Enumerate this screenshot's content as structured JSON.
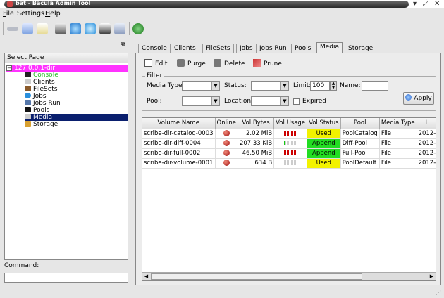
{
  "window": {
    "title": "bat - Bacula Admin Tool",
    "controls": [
      "▾",
      "⤢",
      "✕"
    ]
  },
  "menu": [
    "File",
    "Settings",
    "Help"
  ],
  "left": {
    "select_page_label": "Select Page",
    "root": "127.0.0.1-dir",
    "items": [
      "Console",
      "Clients",
      "FileSets",
      "Jobs",
      "Jobs Run",
      "Pools",
      "Media",
      "Storage"
    ],
    "selected": "Media",
    "command_label": "Command:"
  },
  "tabs": [
    "Console",
    "Clients",
    "FileSets",
    "Jobs",
    "Jobs Run",
    "Pools",
    "Media",
    "Storage"
  ],
  "active_tab": "Media",
  "actions": {
    "edit": "Edit",
    "purge": "Purge",
    "delete": "Delete",
    "prune": "Prune"
  },
  "filter": {
    "title": "Filter",
    "media_type_label": "Media Type:",
    "status_label": "Status:",
    "limit_label": "Limit:",
    "limit_value": "100",
    "name_label": "Name:",
    "pool_label": "Pool:",
    "location_label": "Location:",
    "expired_label": "Expired",
    "apply_label": "Apply"
  },
  "table": {
    "columns": [
      "Volume Name",
      "Online",
      "Vol Bytes",
      "Vol Usage",
      "Vol Status",
      "Pool",
      "Media Type",
      "L"
    ],
    "rows": [
      {
        "name": "scribe-dir-catalog-0003",
        "bytes": "2.02 MiB",
        "usage_fraction": 1.0,
        "usage_color": "red",
        "status": "Used",
        "status_color": "#f2f200",
        "pool": "PoolCatalog",
        "media_type": "File",
        "last": "2012-"
      },
      {
        "name": "scribe-dir-diff-0004",
        "bytes": "207.33 KiB",
        "usage_fraction": 0.15,
        "usage_color": "green",
        "status": "Append",
        "status_color": "#22dd22",
        "pool": "Diff-Pool",
        "media_type": "File",
        "last": "2012-"
      },
      {
        "name": "scribe-dir-full-0002",
        "bytes": "46.50 MiB",
        "usage_fraction": 1.0,
        "usage_color": "red",
        "status": "Append",
        "status_color": "#22dd22",
        "pool": "Full-Pool",
        "media_type": "File",
        "last": "2012-"
      },
      {
        "name": "scribe-dir-volume-0001",
        "bytes": "634 B",
        "usage_fraction": 0.0,
        "usage_color": "red",
        "status": "Used",
        "status_color": "#f2f200",
        "pool": "PoolDefault",
        "media_type": "File",
        "last": "2012-"
      }
    ]
  },
  "colors": {
    "root_highlight": "#ff33ff",
    "selected_row": "#0a1f6e",
    "console_text": "#22bb22"
  }
}
